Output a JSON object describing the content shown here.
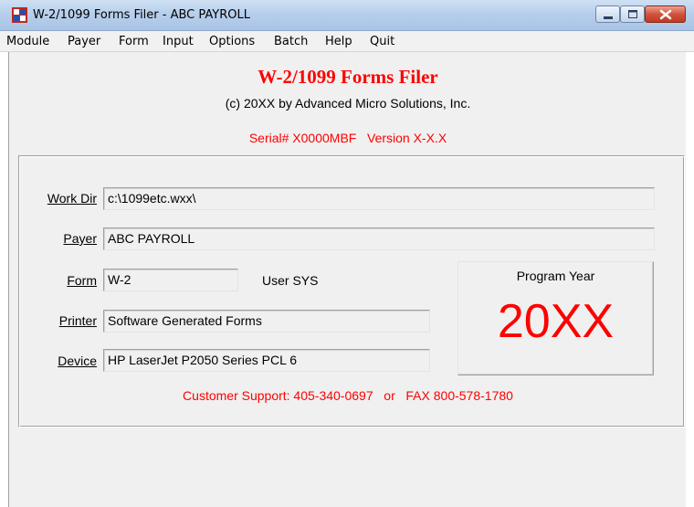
{
  "window": {
    "title": "W-2/1099 Forms Filer - ABC PAYROLL"
  },
  "menu": {
    "items": [
      "Module",
      "Payer",
      "Form",
      "Input",
      "Options",
      "Batch",
      "Help",
      "Quit"
    ]
  },
  "header": {
    "title": "W-2/1099 Forms Filer",
    "copyright": "(c) 20XX by Advanced Micro Solutions, Inc.",
    "serial": "Serial# X0000MBF   Version X-X.X"
  },
  "fields": {
    "work_dir": {
      "label": "Work Dir",
      "value": "c:\\1099etc.wxx\\"
    },
    "payer": {
      "label": "Payer",
      "value": "ABC PAYROLL"
    },
    "form": {
      "label": "Form",
      "value": "W-2"
    },
    "user": "User SYS",
    "printer": {
      "label": "Printer",
      "value": "Software Generated Forms"
    },
    "device": {
      "label": "Device",
      "value": "HP LaserJet P2050 Series PCL 6"
    }
  },
  "program_year": {
    "label": "Program Year",
    "value": "20XX"
  },
  "support": "Customer Support: 405-340-0697   or   FAX 800-578-1780",
  "colors": {
    "accent": "#ff0000",
    "background": "#f0f0f0"
  }
}
